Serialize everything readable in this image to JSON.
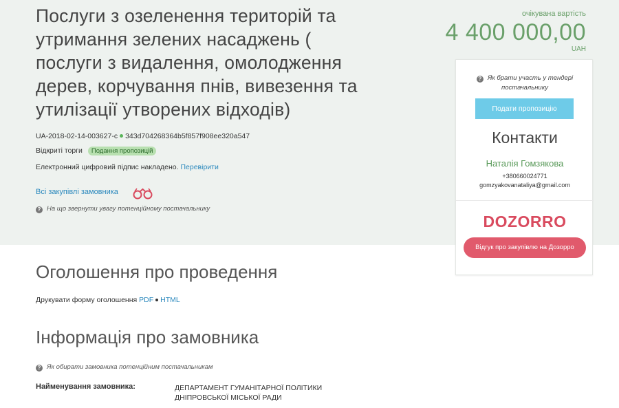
{
  "tender": {
    "title": "Послуги з озеленення територій та утримання зелених насаджень ( послуги з видалення, омолодження дерев, корчування пнів, вивезення та утилізації утворених відходів)",
    "id": "UA-2018-02-14-003627-c",
    "hash": "343d704268364b5f857f908ee320a547",
    "procedure": "Відкриті торги",
    "status_badge": "Подання пропозицій",
    "signature_text": "Електронний цифровий підпис накладено.",
    "verify_link": "Перевірити",
    "all_purchases_link": "Всі закупівлі замовника",
    "attention_hint": "На що звернути увагу потенційному постачальнику"
  },
  "value": {
    "label": "очікувана вартість",
    "amount": "4 400 000,00",
    "currency": "UAH"
  },
  "panel": {
    "how_to_hint": "Як брати участь у тендері постачальнику",
    "submit_button": "Подати пропозицію",
    "contacts_heading": "Контакти",
    "contact_name": "Наталія Гомзякова",
    "contact_phone": "+380660024771",
    "contact_email": "gomzyakovanataliya@gmail.com",
    "dozorro_logo": "DOZORRO",
    "dozorro_button": "Відгук про закупівлю на Дозорро"
  },
  "announcement": {
    "heading": "Оголошення про проведення",
    "print_label": "Друкувати форму оголошення",
    "pdf_link": "PDF",
    "html_link": "HTML"
  },
  "customer": {
    "heading": "Інформація про замовника",
    "hint": "Як обирати замовника потенційним постачальникам",
    "name_label": "Найменування замовника:",
    "name_value": "ДЕПАРТАМЕНТ ГУМАНІТАРНОЇ ПОЛІТИКИ ДНІПРОВСЬКОЇ МІСЬКОЇ РАДИ"
  },
  "colors": {
    "hero_bg": "#eef2ef",
    "accent_green": "#6aa06a",
    "link_blue": "#2a88bd",
    "submit_blue": "#6ecbe8",
    "dozorro_red": "#e15a6c"
  }
}
